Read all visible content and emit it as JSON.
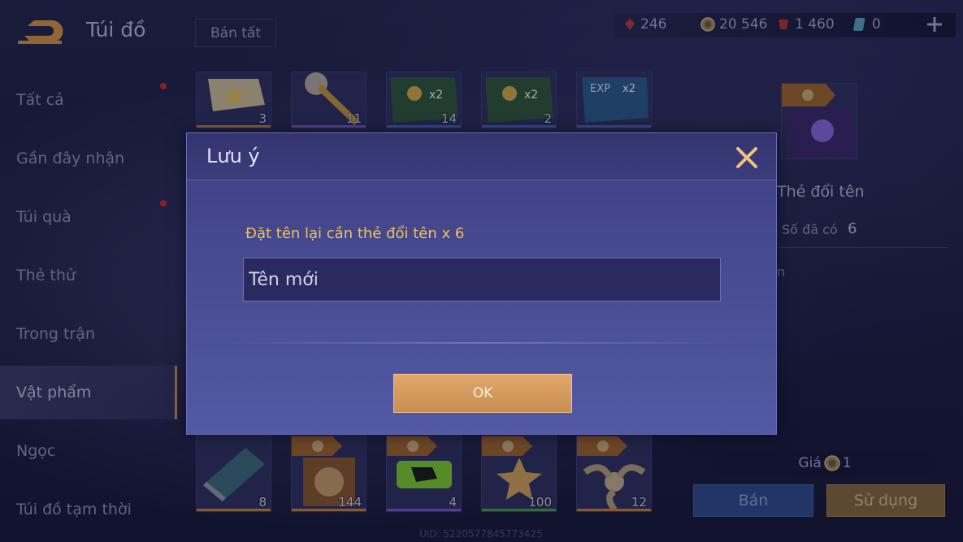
{
  "header": {
    "title": "Túi đồ",
    "sell_all_label": "Bán tất"
  },
  "currencies": [
    {
      "name": "ruby",
      "value": "246",
      "icon": "ruby-icon"
    },
    {
      "name": "gold",
      "value": "20 546",
      "icon": "gold-coin-icon"
    },
    {
      "name": "red-gem",
      "value": "1 460",
      "icon": "red-gem-icon"
    },
    {
      "name": "ticket",
      "value": "0",
      "icon": "ticket-icon"
    }
  ],
  "sidebar": {
    "items": [
      {
        "label": "Tất cả",
        "has_dot": true
      },
      {
        "label": "Gần đây nhận",
        "has_dot": false
      },
      {
        "label": "Túi quà",
        "has_dot": true
      },
      {
        "label": "Thẻ thử",
        "has_dot": false
      },
      {
        "label": "Trong trận",
        "has_dot": false
      },
      {
        "label": "Vật phẩm",
        "active": true
      },
      {
        "label": "Ngọc",
        "has_dot": false
      },
      {
        "label": "Túi đồ tạm thời",
        "has_dot": false
      }
    ]
  },
  "grid": {
    "top_row": [
      {
        "name": "star-badge",
        "count": "3",
        "bar": "#c8873c"
      },
      {
        "name": "scepter",
        "count": "11",
        "bar": "#7a5bd0"
      },
      {
        "name": "gold-x2-card",
        "count": "14",
        "bar": "#4a66c8"
      },
      {
        "name": "gold-x2-card",
        "count": "2",
        "bar": "#4a66c8"
      },
      {
        "name": "exp-x2-card",
        "count": "",
        "bar": "#4a66c8"
      }
    ],
    "bottom_row": [
      {
        "name": "scroll-map",
        "count": "8",
        "bar": "#c8873c"
      },
      {
        "name": "armor-chest",
        "count": "144",
        "bar": "#c8873c"
      },
      {
        "name": "green-card",
        "count": "4",
        "bar": "#7a5bd0"
      },
      {
        "name": "star-gem",
        "count": "100",
        "bar": "#4ea04c"
      },
      {
        "name": "spinner",
        "count": "12",
        "bar": "#c8873c"
      }
    ]
  },
  "detail": {
    "name": "Thẻ đổi tên",
    "owned_label": "Số đã có",
    "owned_value": "6",
    "desc": "n",
    "price_label": "Giá",
    "price_value": "1",
    "sell_label": "Bán",
    "use_label": "Sử dụng"
  },
  "uid": "UID: 5220577845773425",
  "modal": {
    "title": "Lưu ý",
    "message": "Đặt tên lại cần thẻ đổi tên x 6",
    "input_placeholder": "Tên mới",
    "ok_label": "OK"
  }
}
